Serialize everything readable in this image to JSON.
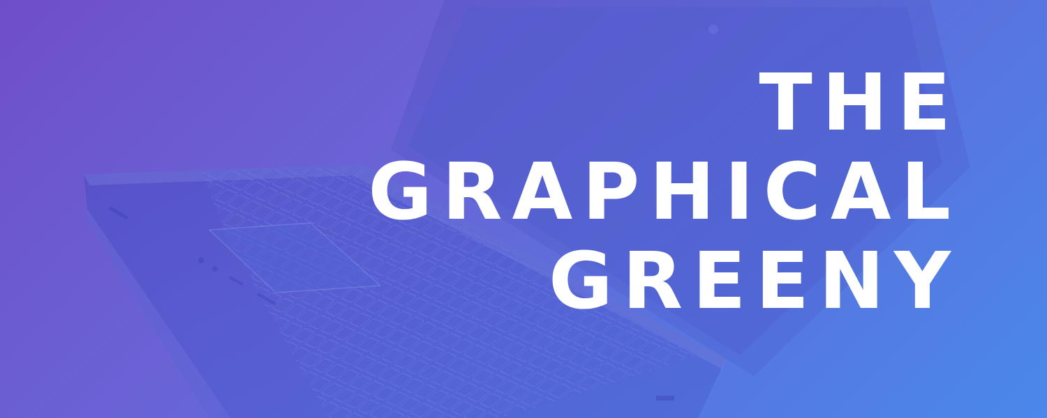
{
  "banner": {
    "title_lines": [
      "THE",
      "GRAPHICAL",
      "GREENY"
    ],
    "background_image": "laptop-photo",
    "colors": {
      "gradient_start": "#6f4fc9",
      "gradient_mid": "#6a62d6",
      "gradient_end": "#4a88ea",
      "title": "#ffffff"
    }
  }
}
